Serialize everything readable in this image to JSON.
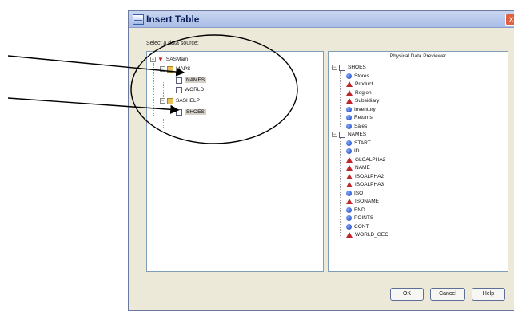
{
  "window": {
    "title": "Insert Table",
    "close_label": "x"
  },
  "data_source": {
    "label": "Select a data source:",
    "tree": {
      "root": "SASMain",
      "libraries": [
        {
          "name": "MAPS",
          "tables": [
            "NAMES",
            "WORLD"
          ]
        },
        {
          "name": "SASHELP",
          "tables": [
            "SHOES"
          ]
        }
      ]
    }
  },
  "previewer": {
    "title": "Physical Data Previewer",
    "tables": [
      {
        "name": "SHOES",
        "columns": [
          {
            "name": "Stores",
            "kind": "numeric"
          },
          {
            "name": "Product",
            "kind": "character"
          },
          {
            "name": "Region",
            "kind": "character"
          },
          {
            "name": "Subsidiary",
            "kind": "character"
          },
          {
            "name": "Inventory",
            "kind": "numeric"
          },
          {
            "name": "Returns",
            "kind": "numeric"
          },
          {
            "name": "Sales",
            "kind": "numeric"
          }
        ]
      },
      {
        "name": "NAMES",
        "columns": [
          {
            "name": "START",
            "kind": "numeric"
          },
          {
            "name": "ID",
            "kind": "numeric"
          },
          {
            "name": "GLCALPHA2",
            "kind": "character"
          },
          {
            "name": "NAME",
            "kind": "character"
          },
          {
            "name": "ISOALPHA2",
            "kind": "character"
          },
          {
            "name": "ISOALPHA3",
            "kind": "character"
          },
          {
            "name": "ISO",
            "kind": "numeric"
          },
          {
            "name": "ISONAME",
            "kind": "character"
          },
          {
            "name": "END",
            "kind": "numeric"
          },
          {
            "name": "POINTS",
            "kind": "numeric"
          },
          {
            "name": "CONT",
            "kind": "numeric"
          },
          {
            "name": "WORLD_GEO",
            "kind": "character"
          }
        ]
      }
    ]
  },
  "buttons": {
    "ok": "OK",
    "cancel": "Cancel",
    "help": "Help"
  },
  "colors": {
    "numeric_icon": "#1d3fb8",
    "character_icon": "#c0262a",
    "annotation": "#000000"
  }
}
